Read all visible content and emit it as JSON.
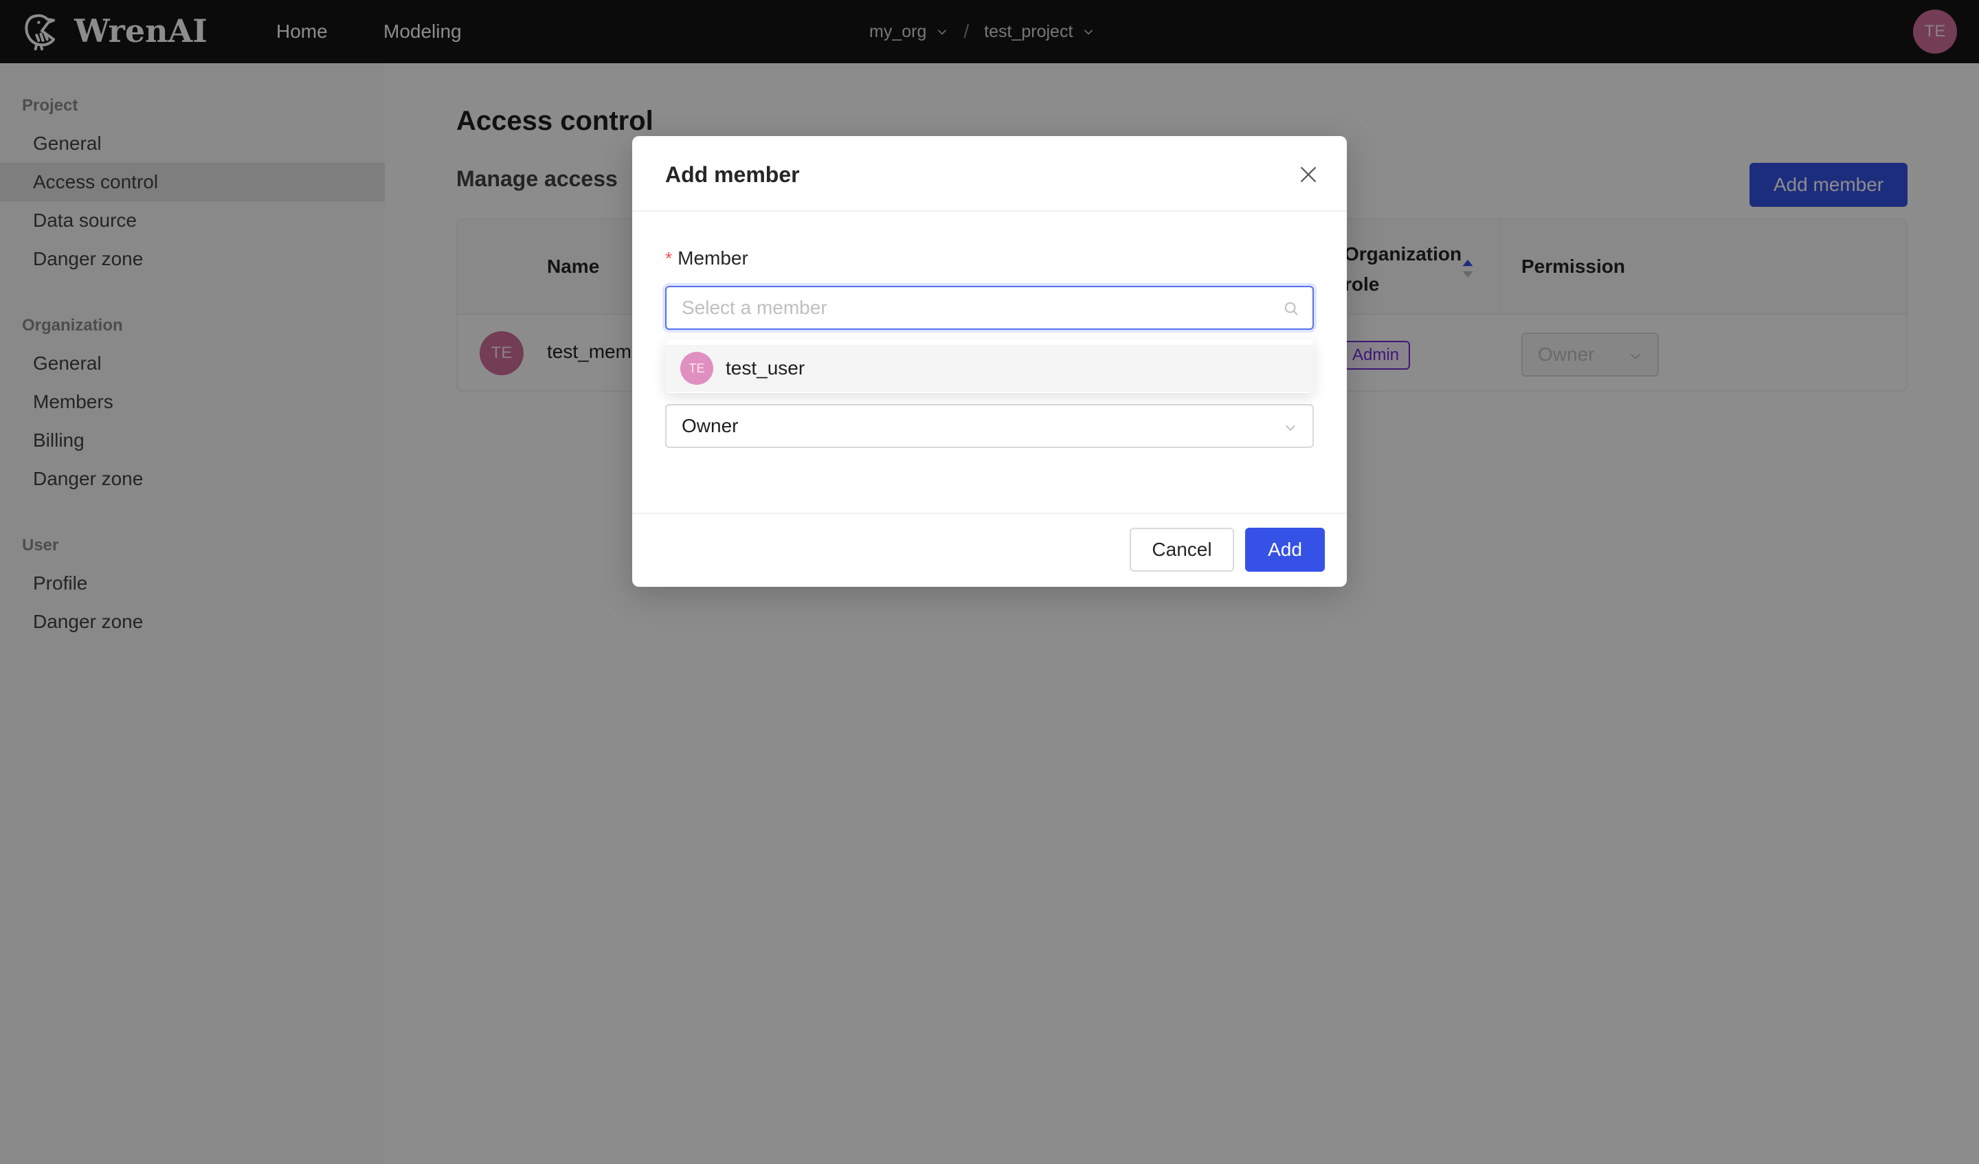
{
  "app": {
    "brand": "WrenAI",
    "nav": [
      {
        "label": "Home"
      },
      {
        "label": "Modeling"
      }
    ],
    "breadcrumb": {
      "organization": "my_org",
      "separator": "/",
      "project": "test_project"
    },
    "user_avatar_initials": "TE"
  },
  "sidebar": {
    "groups": [
      {
        "title": "Project",
        "items": [
          {
            "label": "General"
          },
          {
            "label": "Access control",
            "active": true
          },
          {
            "label": "Data source"
          },
          {
            "label": "Danger zone"
          }
        ]
      },
      {
        "title": "Organization",
        "items": [
          {
            "label": "General"
          },
          {
            "label": "Members"
          },
          {
            "label": "Billing"
          },
          {
            "label": "Danger zone"
          }
        ]
      },
      {
        "title": "User",
        "items": [
          {
            "label": "Profile"
          },
          {
            "label": "Danger zone"
          }
        ]
      }
    ]
  },
  "page": {
    "title": "Access control",
    "section_title": "Manage access",
    "add_member_label": "Add member",
    "table": {
      "columns": [
        "Name",
        "Organization role",
        "Permission"
      ],
      "org_role_header_line1": "Organization",
      "org_role_header_line2": "role",
      "rows": [
        {
          "avatar_initials": "TE",
          "name": "test_member",
          "name_visible": "test_mem",
          "org_role": "Admin",
          "permission": "Owner"
        }
      ]
    }
  },
  "modal": {
    "title": "Add member",
    "member_label": "Member",
    "required_mark": "*",
    "member_placeholder": "Select a member",
    "options": [
      {
        "avatar_initials": "TE",
        "label": "test_user"
      }
    ],
    "permission_value": "Owner",
    "cancel_label": "Cancel",
    "add_label": "Add"
  },
  "colors": {
    "primary": "#3652e6",
    "topbar": "#141414",
    "avatar": "#d16f9c",
    "admin_badge": "#722ed1",
    "required": "#ff4d4f"
  }
}
